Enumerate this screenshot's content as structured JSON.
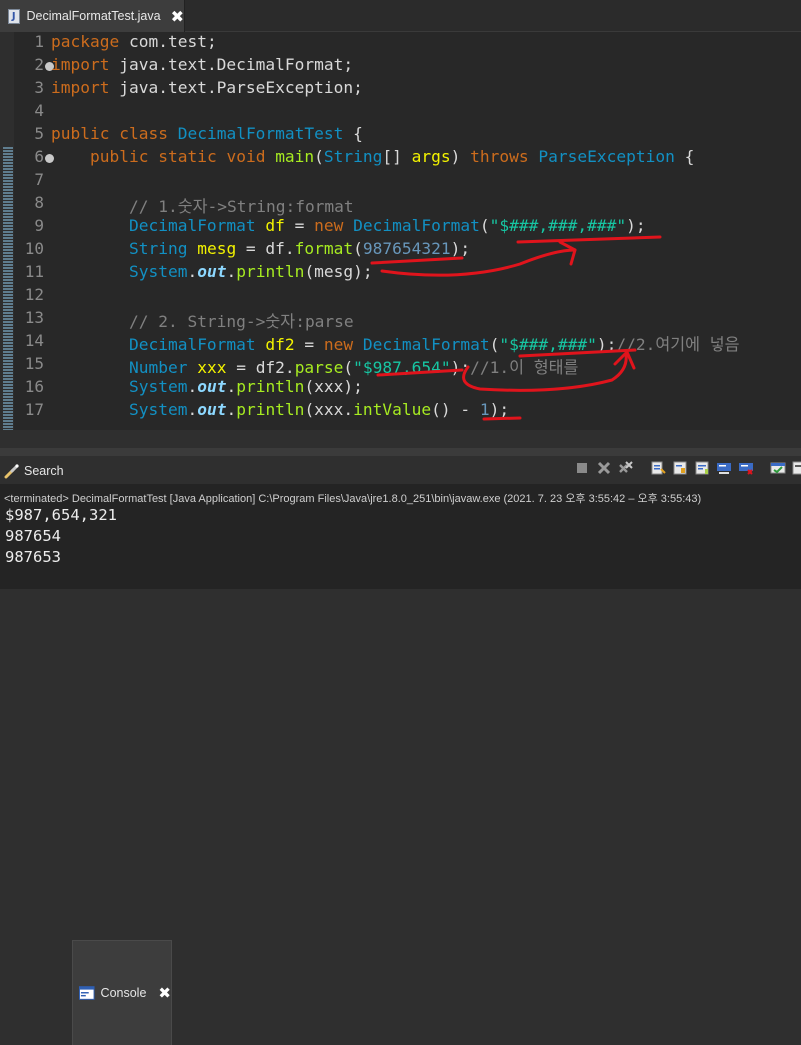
{
  "editor_tab": {
    "title": "DecimalFormatTest.java",
    "close": "✖",
    "icon_letter": "J"
  },
  "line_numbers": [
    "1",
    "2",
    "3",
    "4",
    "5",
    "6",
    "7",
    "8",
    "9",
    "10",
    "11",
    "12",
    "13",
    "14",
    "15",
    "16",
    "17"
  ],
  "code": {
    "l1": {
      "kw": "package",
      "rest": " com.test;"
    },
    "l2": {
      "kw": "import",
      "rest": " java.text.DecimalFormat;"
    },
    "l3": {
      "kw": "import",
      "rest": " java.text.ParseException;"
    },
    "l5": {
      "kw1": "public",
      "kw2": "class",
      "cls": "DecimalFormatTest",
      "rest": " {"
    },
    "l6": {
      "indent": "    ",
      "kw1": "public",
      "kw2": "static",
      "kw3": "void",
      "meth": "main",
      "p1": "(",
      "cls": "String",
      "p2": "[] ",
      "var": "args",
      "p3": ") ",
      "kw4": "throws",
      "cls2": "ParseException",
      "rest": " {"
    },
    "l8": {
      "indent": "        ",
      "cmt": "// 1.숫자->String:format"
    },
    "l9": {
      "indent": "        ",
      "cls": "DecimalFormat",
      "var": "df",
      "eq": " = ",
      "kw": "new",
      "cls2": "DecimalFormat",
      "p1": "(",
      "str": "\"$###,###,###\"",
      "p2": ");"
    },
    "l10": {
      "indent": "        ",
      "cls": "String",
      "var": "mesg",
      "eq": " = df.",
      "meth": "format",
      "p1": "(",
      "num": "987654321",
      "p2": ");"
    },
    "l11": {
      "indent": "        ",
      "cls": "System",
      "dot1": ".",
      "fld": "out",
      "dot2": ".",
      "meth": "println",
      "rest": "(mesg);"
    },
    "l13": {
      "indent": "        ",
      "cmt": "// 2. String->숫자:parse"
    },
    "l14": {
      "indent": "        ",
      "cls": "DecimalFormat",
      "var": "df2",
      "eq": " = ",
      "kw": "new",
      "cls2": "DecimalFormat",
      "p1": "(",
      "str": "\"$###,###\"",
      "p2": ");",
      "cmt": "//2.여기에 넣음"
    },
    "l15": {
      "indent": "        ",
      "cls": "Number",
      "var": "xxx",
      "eq": " = df2.",
      "meth": "parse",
      "p1": "(",
      "str": "\"$987,654\"",
      "p2": ");",
      "cmt": "//1.이 형태를"
    },
    "l16": {
      "indent": "        ",
      "cls": "System",
      "dot1": ".",
      "fld": "out",
      "dot2": ".",
      "meth": "println",
      "rest": "(xxx);"
    },
    "l17": {
      "indent": "        ",
      "cls": "System",
      "dot1": ".",
      "fld": "out",
      "dot2": ".",
      "meth": "println",
      "p1": "(xxx.",
      "meth2": "intValue",
      "p2": "() - ",
      "num": "1",
      "p3": ");"
    }
  },
  "hscroll": {
    "left_arrow": "<"
  },
  "views": {
    "search_label": "Search",
    "console_label": "Console",
    "console_close": "✖"
  },
  "console": {
    "header": "<terminated> DecimalFormatTest [Java Application] C:\\Program Files\\Java\\jre1.8.0_251\\bin\\javaw.exe  (2021. 7. 23 오후 3:55:42 – 오후 3:55:43)",
    "output": [
      "$987,654,321",
      "987654",
      "987653"
    ]
  },
  "colors": {
    "keyword": "#cc6c1d",
    "class": "#1290c3",
    "variable": "#f2f200",
    "string": "#17c6a3",
    "number": "#6897bb",
    "annotation_pen": "#e0141c"
  }
}
